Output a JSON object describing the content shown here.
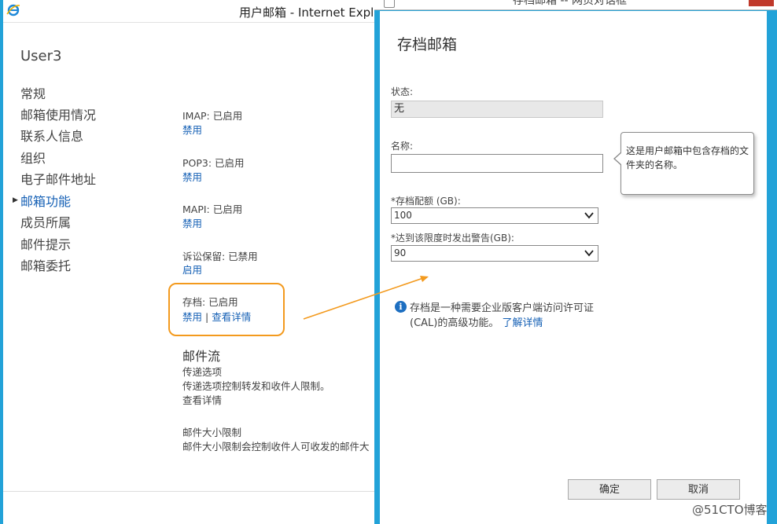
{
  "left_window": {
    "title": "用户邮箱 - Internet Explo",
    "user": "User3",
    "nav": [
      "常规",
      "邮箱使用情况",
      "联系人信息",
      "组织",
      "电子邮件地址",
      "邮箱功能",
      "成员所属",
      "邮件提示",
      "邮箱委托"
    ],
    "active_nav": "邮箱功能",
    "features": {
      "imap": {
        "title": "IMAP: 已启用",
        "link": "禁用"
      },
      "pop3": {
        "title": "POP3: 已启用",
        "link": "禁用"
      },
      "mapi": {
        "title": "MAPI: 已启用",
        "link": "禁用"
      },
      "litigation": {
        "title": "诉讼保留: 已禁用",
        "link": "启用"
      },
      "archive": {
        "title": "存档: 已启用",
        "link_disable": "禁用",
        "separator": "|",
        "link_details": "查看详情"
      }
    },
    "mail_flow": {
      "title": "邮件流",
      "delivery_title": "传递选项",
      "delivery_desc": "传递选项控制转发和收件人限制。",
      "delivery_link": "查看详情",
      "size_title": "邮件大小限制",
      "size_desc": "邮件大小限制会控制收件人可收发的邮件大"
    }
  },
  "dialog": {
    "title": "存档邮箱 -- 网页对话框",
    "heading": "存档邮箱",
    "status_label": "状态:",
    "status_value": "无",
    "name_label": "名称:",
    "name_value": "",
    "tooltip": "这是用户邮箱中包含存档的文件夹的名称。",
    "quota_label": "*存档配额 (GB):",
    "quota_value": "100",
    "warning_label": "*达到该限度时发出警告(GB):",
    "warning_value": "90",
    "info_text_line1": "存档是一种需要企业版客户端访问许可证",
    "info_text_line2": "(CAL)的高级功能。",
    "info_link": "了解详情",
    "ok_button": "确定",
    "cancel_button": "取消"
  },
  "watermark": "@51CTO博客",
  "colors": {
    "accent_border": "#22a2d8",
    "highlight": "#f39a1e",
    "link": "#1560b5"
  }
}
